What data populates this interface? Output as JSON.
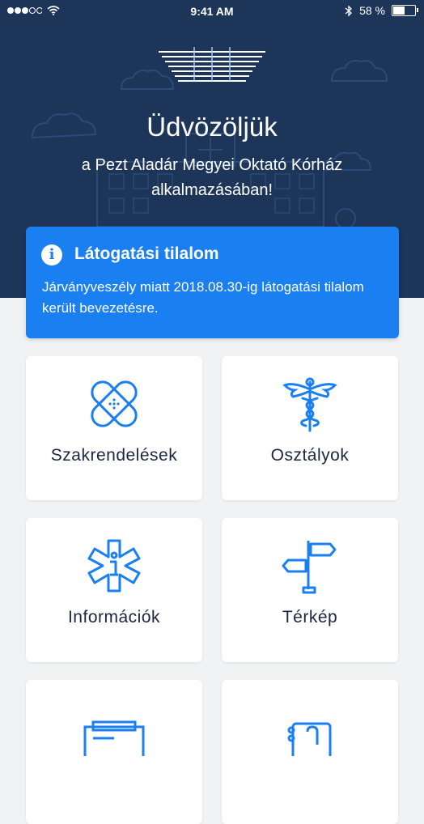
{
  "status_bar": {
    "time": "9:41 AM",
    "battery": "58 %",
    "battery_level": 0.58
  },
  "welcome": {
    "title": "Üdvözöljük",
    "subtitle": "a Pezt Aladár Megyei Oktató Kórház alkalmazásában!"
  },
  "alert": {
    "title": "Látogatási tilalom",
    "body": "Járványveszély miatt 2018.08.30-ig látogatási tilalom került bevezetésre."
  },
  "menu": [
    {
      "label": "Szakrendelések",
      "icon": "bandage-icon"
    },
    {
      "label": "Osztályok",
      "icon": "caduceus-icon"
    },
    {
      "label": "Információk",
      "icon": "medical-info-icon"
    },
    {
      "label": "Térkép",
      "icon": "signpost-icon"
    },
    {
      "label": "",
      "icon": "news-icon"
    },
    {
      "label": "",
      "icon": "contact-book-icon"
    }
  ],
  "colors": {
    "header_bg": "#1d3559",
    "accent": "#1a7ff0",
    "card_text": "#1b2540"
  }
}
